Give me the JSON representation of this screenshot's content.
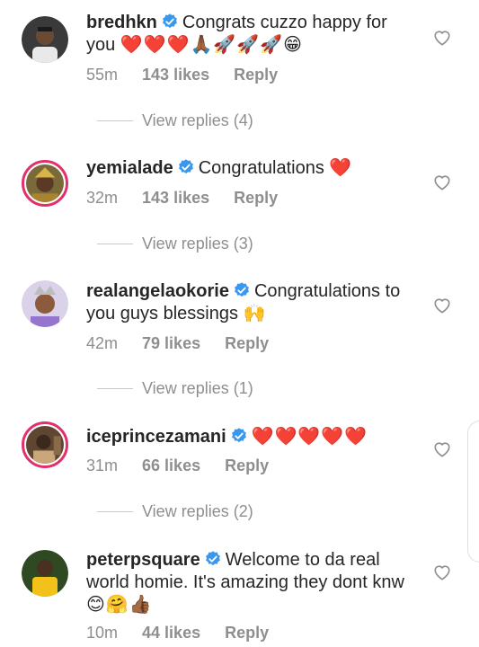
{
  "comments": [
    {
      "username": "bredhkn",
      "text": "Congrats cuzzo happy for you",
      "emojis": "❤️❤️❤️🙏🏾🚀🚀🚀😁",
      "time": "55m",
      "likes": "143 likes",
      "reply": "Reply",
      "view_replies": "View replies (4)",
      "avatar_color": "#2b2b2b"
    },
    {
      "username": "yemialade",
      "text": "Congratulations",
      "emojis": "❤️",
      "time": "32m",
      "likes": "143 likes",
      "reply": "Reply",
      "view_replies": "View replies (3)",
      "avatar_color": "#c9a227"
    },
    {
      "username": "realangelaokorie",
      "text": "Congratulations to you guys blessings",
      "emojis": "🙌",
      "time": "42m",
      "likes": "79 likes",
      "reply": "Reply",
      "view_replies": "View replies (1)",
      "avatar_color": "#b39ddb"
    },
    {
      "username": "iceprincezamani",
      "text": "",
      "emojis": "❤️❤️❤️❤️❤️",
      "time": "31m",
      "likes": "66 likes",
      "reply": "Reply",
      "view_replies": "View replies (2)",
      "avatar_color": "#7a5a3a"
    },
    {
      "username": "peterpsquare",
      "text": "Welcome to da real world homie. It's amazing they dont knw",
      "emojis": "😊🤗👍🏾",
      "time": "10m",
      "likes": "44 likes",
      "reply": "Reply",
      "avatar_color": "#3e5a2a"
    }
  ],
  "colors": {
    "verified_badge": "#3897f0",
    "muted_text": "#8e8e8e",
    "story_ring": "#e1306c"
  },
  "icons": {
    "like": "heart-outline-icon",
    "verified": "verified-badge-icon"
  }
}
